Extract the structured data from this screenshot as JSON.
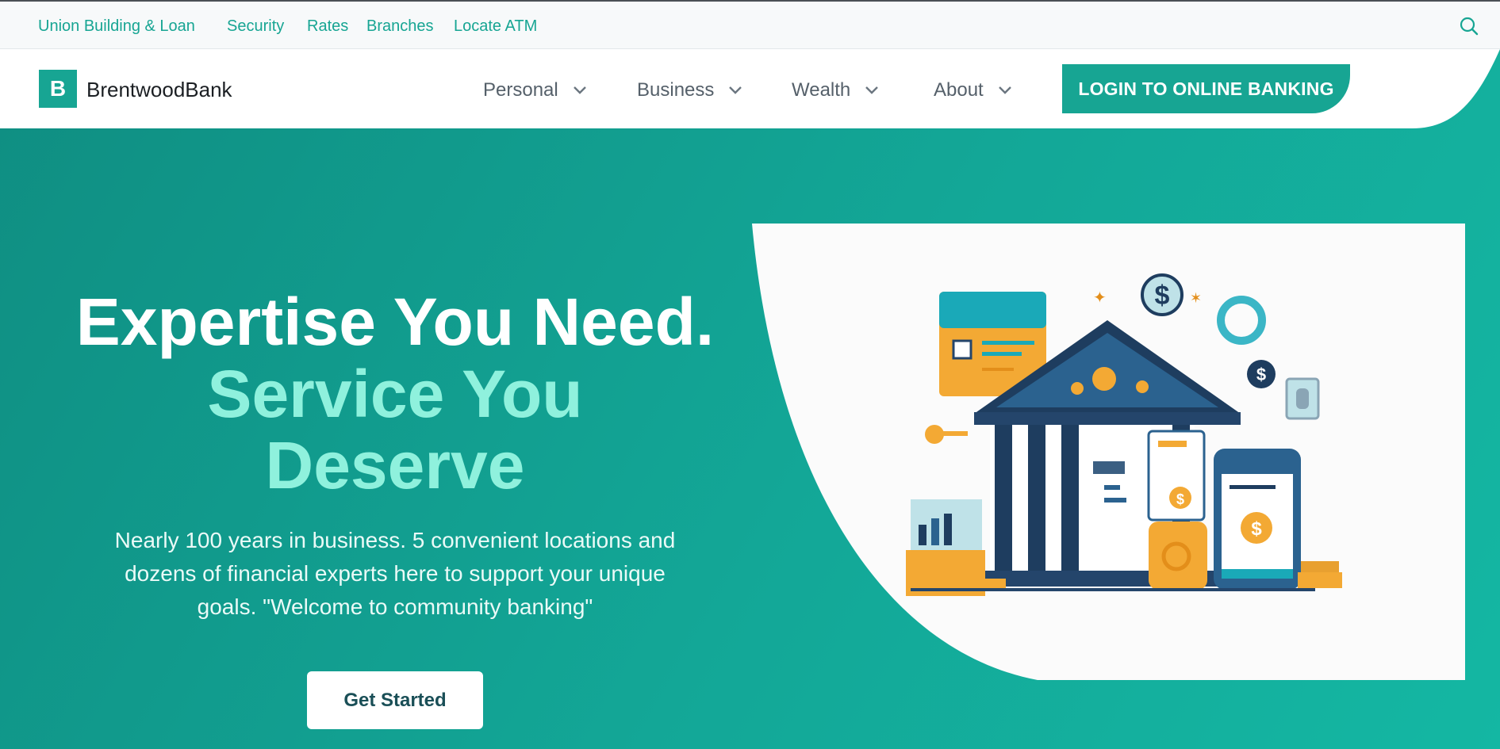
{
  "utility_nav": {
    "links": [
      {
        "label": "Union Building & Loan"
      },
      {
        "label": "Security"
      },
      {
        "label": "Rates"
      },
      {
        "label": "Branches"
      },
      {
        "label": "Locate ATM"
      }
    ],
    "search_icon": "search-icon"
  },
  "brand": {
    "mark": "B",
    "name": "BrentwoodBank",
    "color": "#17a593"
  },
  "main_nav": {
    "items": [
      {
        "label": "Personal",
        "icon": "chevron-down-icon"
      },
      {
        "label": "Business",
        "icon": "chevron-down-icon"
      },
      {
        "label": "Wealth",
        "icon": "chevron-down-icon"
      },
      {
        "label": "About",
        "icon": "chevron-down-icon"
      }
    ],
    "login_label": "LOGIN TO ONLINE BANKING"
  },
  "hero": {
    "headline_line1": "Expertise You Need.",
    "headline_line2": "Service You",
    "headline_line3": "Deserve",
    "subtext_line1": "Nearly 100 years in business. 5 convenient locations and",
    "subtext_line2": "dozens of financial experts here to support your unique",
    "subtext_line3": "goals. \"Welcome to community banking\"",
    "cta_label": "Get Started",
    "accent_color": "#8ff1dd"
  },
  "illustration": {
    "icon": "bank-building-illustration",
    "coin_symbol": "$"
  }
}
